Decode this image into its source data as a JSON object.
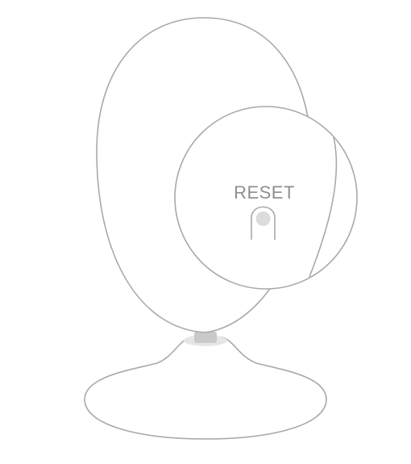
{
  "illustration": {
    "subject": "camera-reset-button-location",
    "reset_label": "RESET",
    "colors": {
      "outline": "#a9a9a9",
      "label": "#8f8f8f",
      "button_fill": "#dcdcdc",
      "neck_fill": "#c9c9c9",
      "neck_base_fill": "#e6e6e6",
      "background": "#ffffff"
    }
  }
}
